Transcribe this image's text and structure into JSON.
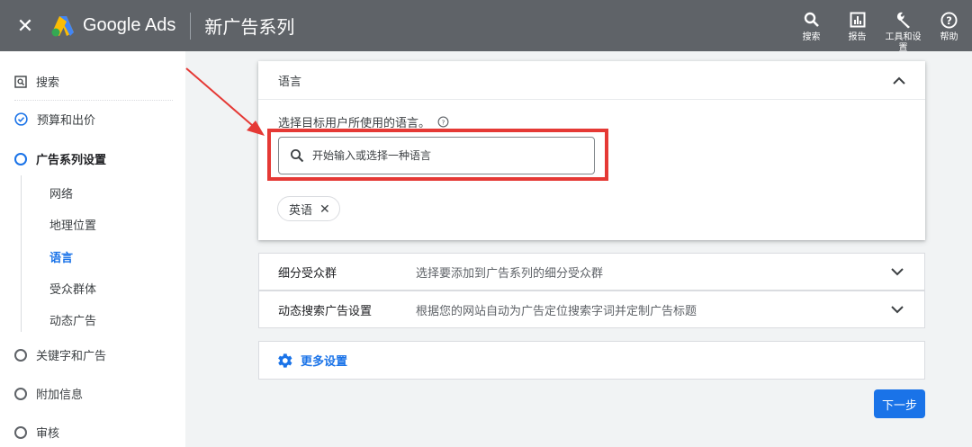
{
  "header": {
    "close_icon": "close-icon",
    "logo_text": "Google Ads",
    "page_title": "新广告系列",
    "actions": [
      {
        "label": "搜索",
        "icon": "search-icon"
      },
      {
        "label": "报告",
        "icon": "report-icon"
      },
      {
        "label": "工具和设置",
        "icon": "wrench-icon"
      },
      {
        "label": "帮助",
        "icon": "help-icon"
      }
    ]
  },
  "sidebar": {
    "search_label": "搜索",
    "steps": [
      {
        "label": "预算和出价",
        "state": "done"
      },
      {
        "label": "广告系列设置",
        "state": "current"
      },
      {
        "label": "关键字和广告",
        "state": "todo"
      },
      {
        "label": "附加信息",
        "state": "todo"
      },
      {
        "label": "审核",
        "state": "todo"
      }
    ],
    "sub_items": [
      "网络",
      "地理位置",
      "语言",
      "受众群体",
      "动态广告"
    ],
    "active_sub": "语言"
  },
  "language_card": {
    "title": "语言",
    "prompt": "选择目标用户所使用的语言。",
    "search_placeholder": "开始输入或选择一种语言",
    "selected_chip": "英语"
  },
  "sections": [
    {
      "title": "细分受众群",
      "desc": "选择要添加到广告系列的细分受众群"
    },
    {
      "title": "动态搜索广告设置",
      "desc": "根据您的网站自动为广告定位搜索字词并定制广告标题"
    }
  ],
  "more_settings_label": "更多设置",
  "next_button": "下一步",
  "colors": {
    "header_bg": "#5f6368",
    "accent": "#1a73e8",
    "highlight": "#e53935"
  }
}
